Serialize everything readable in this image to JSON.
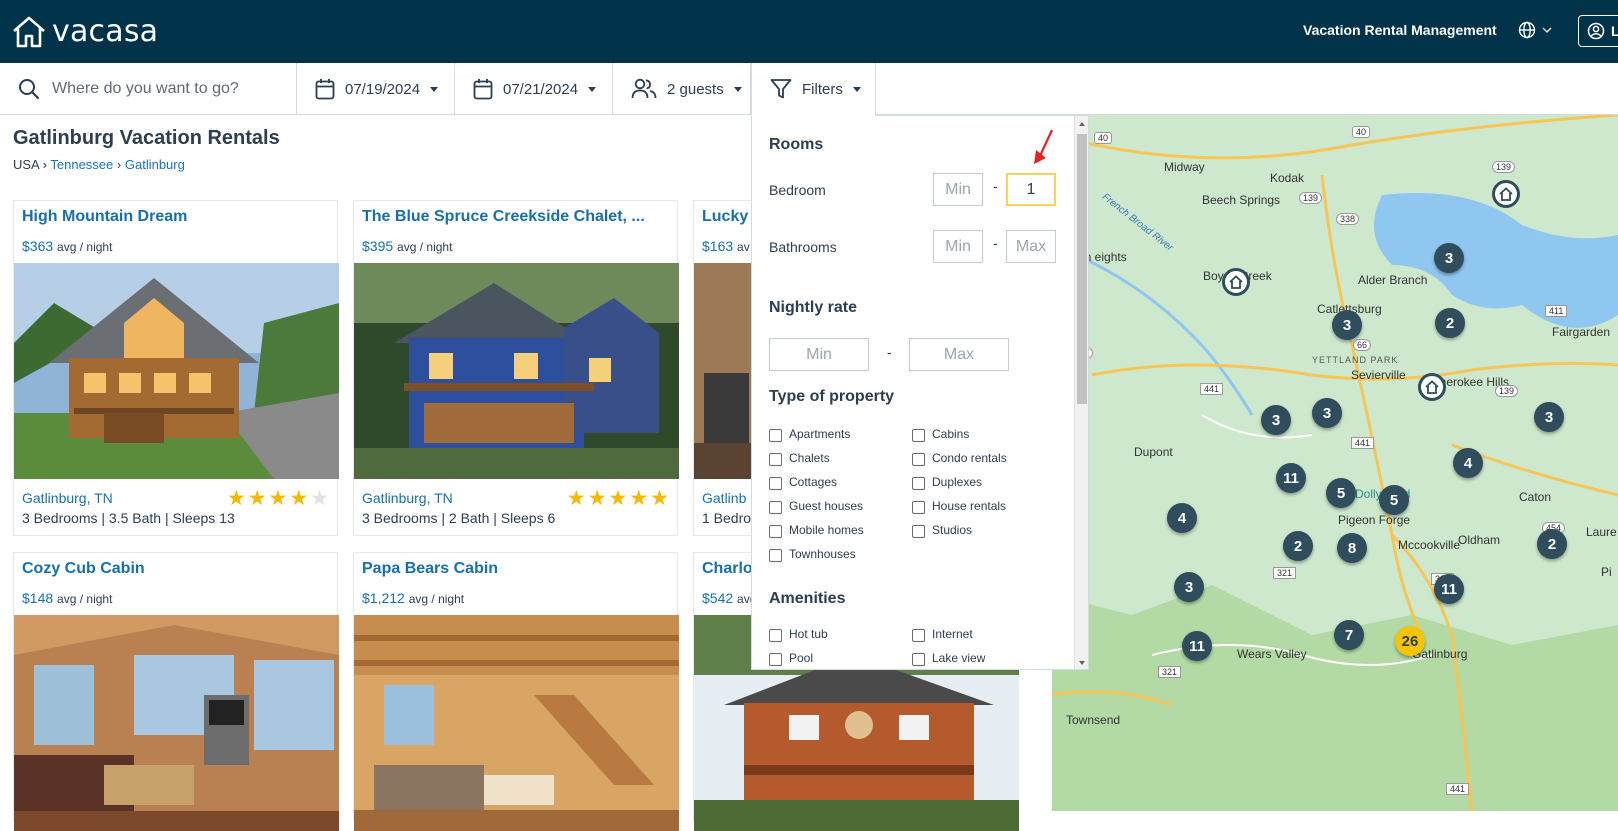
{
  "header": {
    "brand": "vacasa",
    "nav_link": "Vacation Rental Management",
    "login_label": "L"
  },
  "search": {
    "placeholder": "Where do you want to go?",
    "checkin": "07/19/2024",
    "checkout": "07/21/2024",
    "guests": "2 guests",
    "filters_label": "Filters"
  },
  "page": {
    "title": "Gatlinburg Vacation Rentals",
    "breadcrumb": [
      "USA",
      "Tennessee",
      "Gatlinburg"
    ],
    "breadcrumb_sep": "›"
  },
  "listings": [
    {
      "name": "High Mountain Dream",
      "price": "$363",
      "price_unit": "avg / night",
      "location": "Gatlinburg, TN",
      "specs": "3 Bedrooms | 3.5 Bath | Sleeps 13",
      "rating": 4
    },
    {
      "name": "The Blue Spruce Creekside Chalet, ...",
      "price": "$395",
      "price_unit": "avg / night",
      "location": "Gatlinburg, TN",
      "specs": "3 Bedrooms | 2 Bath | Sleeps 6",
      "rating": 5
    },
    {
      "name": "Lucky",
      "price": "$163",
      "price_unit": "av",
      "location": "Gatlinb",
      "specs": "1 Bedro"
    },
    {
      "name": "Cozy Cub Cabin",
      "price": "$148",
      "price_unit": "avg / night"
    },
    {
      "name": "Papa Bears Cabin",
      "price": "$1,212",
      "price_unit": "avg / night"
    },
    {
      "name": "Charlo",
      "price": "$542",
      "price_unit": "avg / night"
    }
  ],
  "filters": {
    "rooms_heading": "Rooms",
    "bedroom_label": "Bedroom",
    "bedroom_min_placeholder": "Min",
    "bedroom_max_value": "1",
    "bathrooms_label": "Bathrooms",
    "bathrooms_min_placeholder": "Min",
    "bathrooms_max_placeholder": "Max",
    "nightly_heading": "Nightly rate",
    "nightly_min_placeholder": "Min",
    "nightly_max_placeholder": "Max",
    "dash": "-",
    "property_heading": "Type of property",
    "property_types": [
      "Apartments",
      "Cabins",
      "Chalets",
      "Condo rentals",
      "Cottages",
      "Duplexes",
      "Guest houses",
      "House rentals",
      "Mobile homes",
      "Studios",
      "Townhouses"
    ],
    "amenities_heading": "Amenities",
    "amenities": [
      "Hot tub",
      "Internet",
      "Pool",
      "Lake view"
    ]
  },
  "map": {
    "places": [
      "Midway",
      "Kodak",
      "Beech Springs",
      "French Broad River",
      "mberlin eights",
      "Boyds Creek",
      "Alder Branch",
      "Catlettsburg",
      "Fairgarden",
      "YETTLAND PARK",
      "Sevierville",
      "Cherokee Hills",
      "Dupont",
      "Dollywood",
      "Pigeon Forge",
      "Caton",
      "Oldham",
      "Laure",
      "Pi",
      "Mccookville",
      "Wears Valley",
      "Gatlinburg",
      "Townsend"
    ],
    "road_shields": [
      "40",
      "40",
      "139",
      "139",
      "338",
      "66",
      "338",
      "441",
      "411",
      "139",
      "441",
      "454",
      "321",
      "321",
      "321",
      "441"
    ],
    "clusters": [
      "3",
      "3",
      "2",
      "3",
      "3",
      "3",
      "4",
      "11",
      "5",
      "5",
      "4",
      "2",
      "8",
      "2",
      "3",
      "11",
      "11",
      "7",
      "26"
    ],
    "colors": {
      "cluster": "#2f4d5c",
      "highlight": "#f5c400",
      "land": "#cfe9cf",
      "water": "#8fc7f0"
    }
  }
}
